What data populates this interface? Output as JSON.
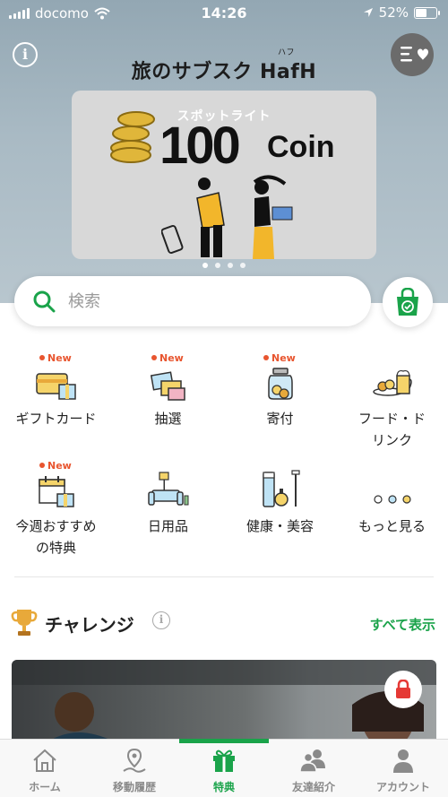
{
  "status_bar": {
    "carrier": "docomo",
    "time": "14:26",
    "battery": "52%"
  },
  "header": {
    "brand": "旅のサブスク HafH",
    "brand_ruby": "ハフ"
  },
  "banner": {
    "spot_title": "スポットライト",
    "amount": "100",
    "unit": "Coin",
    "pages": 4,
    "active_page": 0
  },
  "search": {
    "placeholder": "検索"
  },
  "categories": [
    {
      "label": "ギフトカード",
      "new": true,
      "badge": "New"
    },
    {
      "label": "抽選",
      "new": true,
      "badge": "New"
    },
    {
      "label": "寄付",
      "new": true,
      "badge": "New"
    },
    {
      "label": "フード・ドリンク",
      "new": false
    },
    {
      "label": "今週おすすめの特典",
      "new": true,
      "badge": "New"
    },
    {
      "label": "日用品",
      "new": false
    },
    {
      "label": "健康・美容",
      "new": false
    },
    {
      "label": "もっと見る",
      "new": false
    }
  ],
  "challenge": {
    "title": "チャレンジ",
    "see_all": "すべて表示"
  },
  "tabs": [
    {
      "label": "ホーム",
      "active": false
    },
    {
      "label": "移動履歴",
      "active": false
    },
    {
      "label": "特典",
      "active": true
    },
    {
      "label": "友達紹介",
      "active": false
    },
    {
      "label": "アカウント",
      "active": false
    }
  ],
  "colors": {
    "accent": "#1aa34a",
    "new_badge": "#e8552f"
  }
}
